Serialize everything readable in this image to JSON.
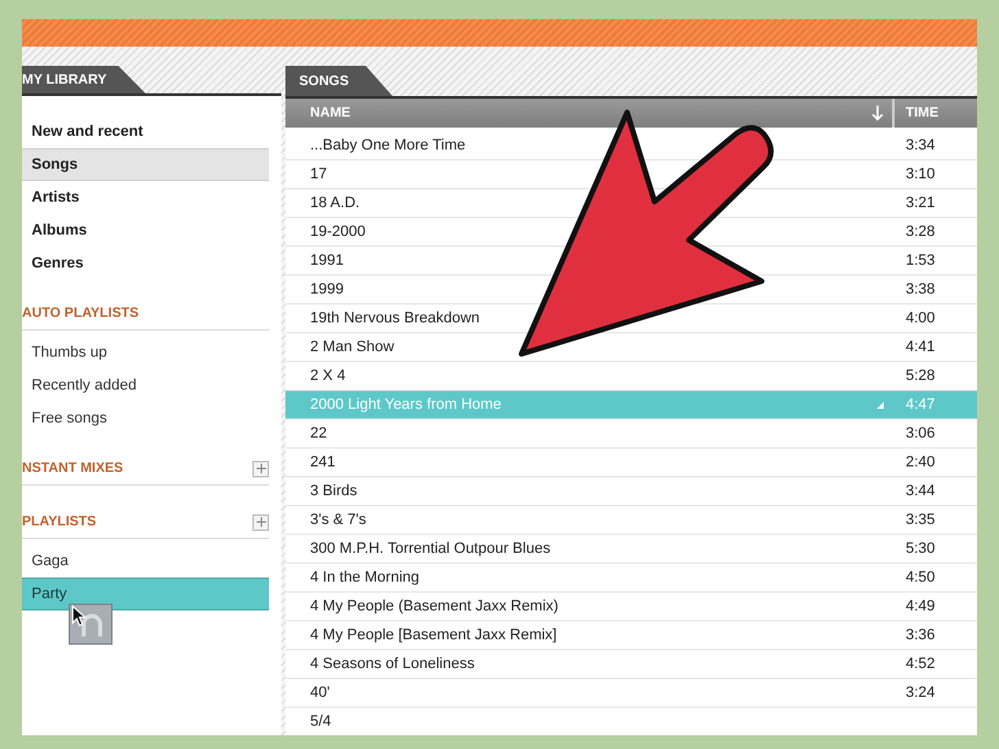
{
  "sidebar": {
    "tab": "MY LIBRARY",
    "library_items": [
      {
        "label": "New and recent",
        "selected": false
      },
      {
        "label": "Songs",
        "selected": true
      },
      {
        "label": "Artists",
        "selected": false
      },
      {
        "label": "Albums",
        "selected": false
      },
      {
        "label": "Genres",
        "selected": false
      }
    ],
    "sections": [
      {
        "title": "AUTO PLAYLISTS",
        "add_button": false,
        "items": [
          {
            "label": "Thumbs up",
            "selected": false
          },
          {
            "label": "Recently added",
            "selected": false
          },
          {
            "label": "Free songs",
            "selected": false
          }
        ]
      },
      {
        "title": "NSTANT MIXES",
        "add_button": true
      },
      {
        "title": "PLAYLISTS",
        "add_button": true,
        "items": [
          {
            "label": "Gaga",
            "selected": false
          },
          {
            "label": "Party",
            "selected": true
          }
        ]
      }
    ]
  },
  "songs": {
    "tab": "SONGS",
    "columns": [
      {
        "label": "NAME",
        "sorted": true
      },
      {
        "label": "TIME",
        "sorted": false
      }
    ],
    "rows": [
      {
        "name": "...Baby One More Time",
        "time": "3:34",
        "selected": false
      },
      {
        "name": "17",
        "time": "3:10",
        "selected": false
      },
      {
        "name": "18 A.D.",
        "time": "3:21",
        "selected": false
      },
      {
        "name": "19-2000",
        "time": "3:28",
        "selected": false
      },
      {
        "name": "1991",
        "time": "1:53",
        "selected": false
      },
      {
        "name": "1999",
        "time": "3:38",
        "selected": false
      },
      {
        "name": "19th Nervous Breakdown",
        "time": "4:00",
        "selected": false
      },
      {
        "name": "2 Man Show",
        "time": "4:41",
        "selected": false
      },
      {
        "name": "2 X 4",
        "time": "5:28",
        "selected": false
      },
      {
        "name": "2000 Light Years from Home",
        "time": "4:47",
        "selected": true
      },
      {
        "name": "22",
        "time": "3:06",
        "selected": false
      },
      {
        "name": "241",
        "time": "2:40",
        "selected": false
      },
      {
        "name": "3 Birds",
        "time": "3:44",
        "selected": false
      },
      {
        "name": "3's & 7's",
        "time": "3:35",
        "selected": false
      },
      {
        "name": "300 M.P.H. Torrential Outpour Blues",
        "time": "5:30",
        "selected": false
      },
      {
        "name": "4 In the Morning",
        "time": "4:50",
        "selected": false
      },
      {
        "name": "4 My People (Basement Jaxx Remix)",
        "time": "4:49",
        "selected": false
      },
      {
        "name": "4 My People [Basement Jaxx Remix]",
        "time": "3:36",
        "selected": false
      },
      {
        "name": "4 Seasons of Loneliness",
        "time": "4:52",
        "selected": false
      },
      {
        "name": "40'",
        "time": "3:24",
        "selected": false
      },
      {
        "name": "5/4",
        "selected": false
      }
    ]
  }
}
